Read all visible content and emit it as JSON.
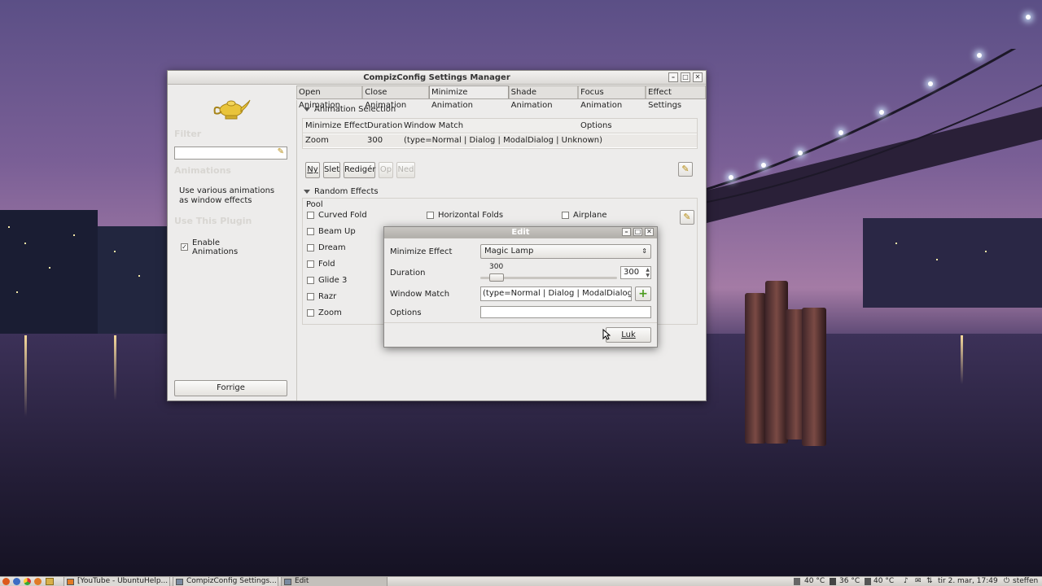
{
  "main_window": {
    "title": "CompizConfig Settings Manager",
    "sidebar": {
      "filter_heading": "Filter",
      "filter_value": "",
      "plugin_heading": "Animations",
      "plugin_description": "Use various animations as window effects",
      "use_plugin_heading": "Use This Plugin",
      "enable_label": "Enable Animations",
      "enable_checked": true,
      "back_button": "Forrige"
    },
    "tabs": [
      {
        "label": "Open Animation",
        "active": false
      },
      {
        "label": "Close Animation",
        "active": false
      },
      {
        "label": "Minimize Animation",
        "active": true
      },
      {
        "label": "Shade Animation",
        "active": false
      },
      {
        "label": "Focus Animation",
        "active": false
      },
      {
        "label": "Effect Settings",
        "active": false
      }
    ],
    "animation_selection": {
      "heading": "Animation Selection",
      "columns": [
        "Minimize Effect",
        "Duration",
        "Window Match",
        "Options"
      ],
      "rows": [
        [
          "Zoom",
          "300",
          "(type=Normal | Dialog | ModalDialog | Unknown)",
          ""
        ]
      ],
      "buttons": {
        "new": "Ny",
        "delete": "Slet",
        "edit": "Redigér",
        "up": "Op",
        "down": "Ned"
      }
    },
    "random_effects": {
      "heading": "Random Effects",
      "pool_label": "Pool",
      "col1": [
        "Curved Fold",
        "Beam Up",
        "Dream",
        "Fold",
        "Glide 3",
        "Razr",
        "Zoom"
      ],
      "col2": [
        "Horizontal Folds"
      ],
      "col3": [
        "Airplane"
      ]
    }
  },
  "edit_dialog": {
    "title": "Edit",
    "minimize_effect_label": "Minimize Effect",
    "minimize_effect_value": "Magic Lamp",
    "duration_label": "Duration",
    "duration_scale_value": "300",
    "duration_spin_value": "300",
    "duration_fraction": 0.03,
    "window_match_label": "Window Match",
    "window_match_value": "(type=Normal | Dialog | ModalDialog | Unl",
    "options_label": "Options",
    "options_value": "",
    "close_button": "Luk"
  },
  "taskbar": {
    "items": [
      {
        "label": "[YouTube - UbuntuHelp...",
        "active": false
      },
      {
        "label": "CompizConfig Settings...",
        "active": false
      },
      {
        "label": "Edit",
        "active": true
      }
    ],
    "temp1": "40 °C",
    "temp2": "36 °C",
    "temp3": "40 °C",
    "clock": "tir  2. mar, 17:49",
    "user": "steffen"
  }
}
